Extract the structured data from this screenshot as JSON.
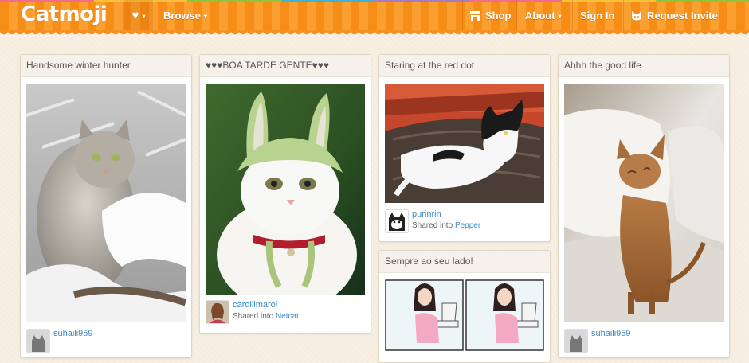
{
  "header": {
    "logo": "Catmoji",
    "heart_symbol": "♥",
    "caret": "▾",
    "browse_label": "Browse",
    "shop_label": "Shop",
    "about_label": "About",
    "signin_label": "Sign In",
    "request_label": "Request Invite",
    "brand_color": "#f68d16"
  },
  "cards": [
    {
      "title": "Handsome winter hunter",
      "user": "suhaili959",
      "photo": "grey-fluffy-cat-on-snowy-branch"
    },
    {
      "title": "♥♥♥BOA TARDE GENTE♥♥♥",
      "user": "carollimarol",
      "shared_prefix": "Shared into",
      "board": "Netcat",
      "photo": "white-cat-in-green-bunny-hat"
    },
    {
      "title": "Staring at the red dot",
      "user": "purinrin",
      "shared_prefix": "Shared into",
      "board": "Pepper",
      "photo": "black-white-cat-lying-on-rug"
    },
    {
      "title": "Sempre ao seu lado!",
      "photo": "comic-girl-on-toilet"
    },
    {
      "title": "Ahhh the good life",
      "user": "suhaili959",
      "photo": "abyssinian-cat-sitting-on-sofa"
    }
  ]
}
